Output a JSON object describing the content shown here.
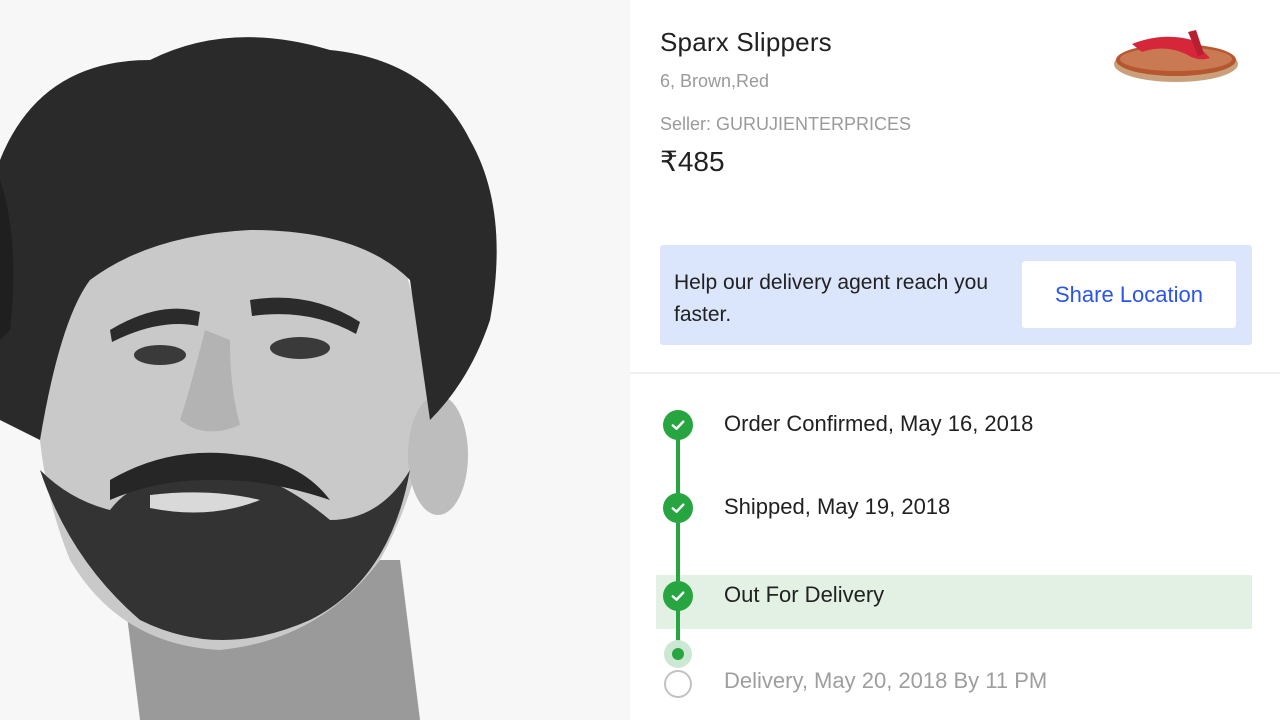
{
  "product": {
    "name": "Sparx Slippers",
    "variant": "6, Brown,Red",
    "seller": "Seller: GURUJIENTERPRICES",
    "price": "₹485"
  },
  "help_banner": {
    "text": "Help our delivery agent reach you faster.",
    "button_label": "Share Location"
  },
  "tracking": {
    "steps": [
      {
        "label": "Order Confirmed, May 16, 2018",
        "status": "done"
      },
      {
        "label": "Shipped, May 19, 2018",
        "status": "done"
      },
      {
        "label": "Out For Delivery",
        "status": "current"
      },
      {
        "label": "Delivery, May 20, 2018 By 11 PM",
        "status": "pending"
      }
    ]
  },
  "colors": {
    "accent_green": "#26a541",
    "highlight_green": "#e3f1e4",
    "banner_blue": "#dbe5fb",
    "link_blue": "#2a55e5"
  }
}
